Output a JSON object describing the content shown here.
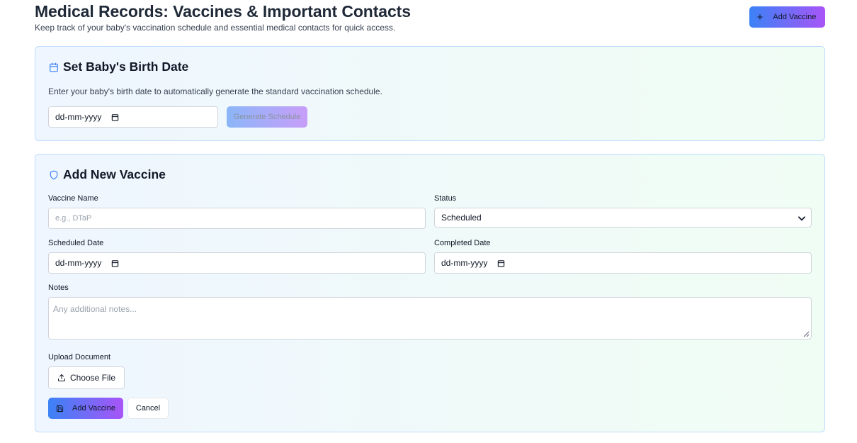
{
  "header": {
    "title": "Medical Records: Vaccines & Important Contacts",
    "subtitle": "Keep track of your baby's vaccination schedule and essential medical contacts for quick access.",
    "add_button_label": "Add Vaccine",
    "add_button_icon": "plus-icon"
  },
  "birth_card": {
    "title": "Set Baby's Birth Date",
    "title_icon": "calendar-icon",
    "description": "Enter your baby's birth date to automatically generate the standard vaccination schedule.",
    "date_placeholder": "dd-mm-yyyy",
    "generate_button_label": "Generate Schedule"
  },
  "vaccine_card": {
    "title": "Add New Vaccine",
    "title_icon": "shield-icon",
    "vaccine_name_label": "Vaccine Name",
    "vaccine_name_placeholder": "e.g., DTaP",
    "status_label": "Status",
    "status_value": "Scheduled",
    "scheduled_date_label": "Scheduled Date",
    "scheduled_date_placeholder": "dd-mm-yyyy",
    "completed_date_label": "Completed Date",
    "completed_date_placeholder": "dd-mm-yyyy",
    "notes_label": "Notes",
    "notes_placeholder": "Any additional notes...",
    "upload_label": "Upload Document",
    "choose_file_label": "Choose File",
    "submit_label": "Add Vaccine",
    "cancel_label": "Cancel"
  },
  "colors": {
    "accent_start": "#3b82f6",
    "accent_end": "#a855f7",
    "card_border": "#bfdbfe"
  }
}
